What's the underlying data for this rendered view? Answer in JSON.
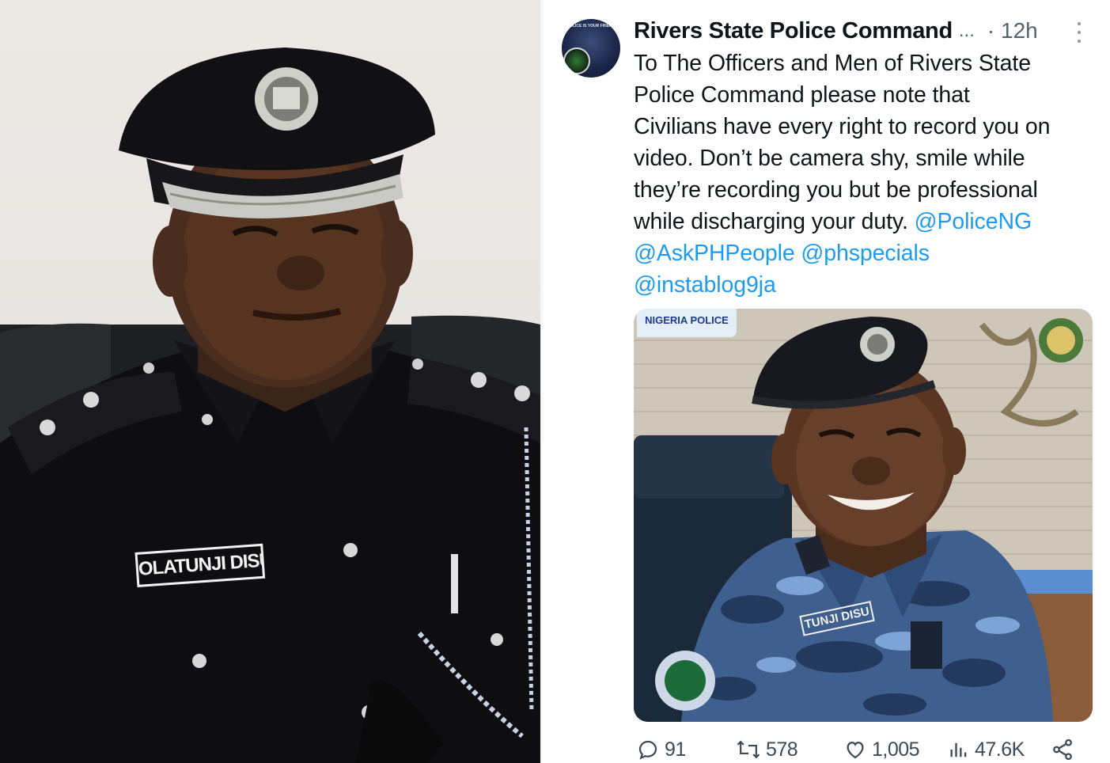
{
  "post": {
    "author": "Rivers State Police Command",
    "ellipsis": "...",
    "time": "· 12h",
    "text_lines": [
      "To The Officers and Men of Rivers State",
      "Police Command please note that",
      "Civilians have every right to record you on",
      "video. Don’t be camera shy, smile while",
      "they’re recording you but be professional",
      "while discharging your duty."
    ],
    "mentions": [
      "@PoliceNG",
      "@AskPHPeople",
      "@phspecials",
      "@instablog9ja"
    ],
    "avatar_text": "POLICE IS YOUR FRIEND"
  },
  "left_photo": {
    "name_tag": "OLATUNJI DISU"
  },
  "media": {
    "name_tag": "TUNJI DISU",
    "wall_sign": "NIGERIA POLICE"
  },
  "actions": {
    "replies": "91",
    "reposts": "578",
    "likes": "1,005",
    "views": "47.6K"
  },
  "colors": {
    "link": "#1d9bf0",
    "text": "#0f1419",
    "muted": "#536471",
    "uniform_black": "#0d0d0f",
    "camo_blue": "#4a6fa5"
  }
}
